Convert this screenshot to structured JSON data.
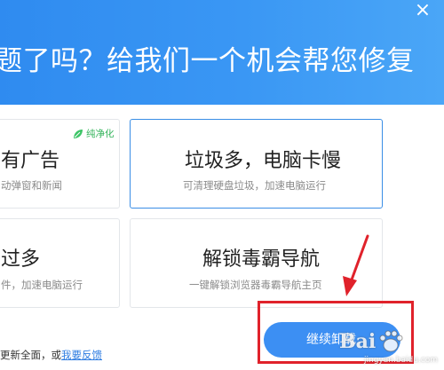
{
  "header": {
    "title": "题了吗？给我们一个机会帮您修复",
    "close_glyph": "×",
    "background": "#3a97f4"
  },
  "cards": [
    {
      "title": "有广告",
      "subtitle": "动弹窗和新闻",
      "badge": "纯净化",
      "selected": false
    },
    {
      "title": "垃圾多，电脑卡慢",
      "subtitle": "可清理硬盘垃圾，加速电脑运行",
      "selected": true
    },
    {
      "title": "过多",
      "subtitle": "件，加速电脑运行",
      "selected": false
    },
    {
      "title": "解锁毒霸导航",
      "subtitle": "一键解锁浏览器毒霸导航主页",
      "selected": false
    }
  ],
  "footer": {
    "text": "更新全面，或",
    "link": "我要反馈"
  },
  "continue_button": {
    "label": "继续卸载"
  },
  "annotation": {
    "box_color": "#e0222b",
    "arrow_color": "#e0222b"
  },
  "watermark": {
    "main": "Bai",
    "sub": "jingyan.baidu.com"
  },
  "icons": {
    "badge_icon": "leaf-icon",
    "close_icon": "close-icon",
    "watermark_icon": "paw-icon"
  }
}
